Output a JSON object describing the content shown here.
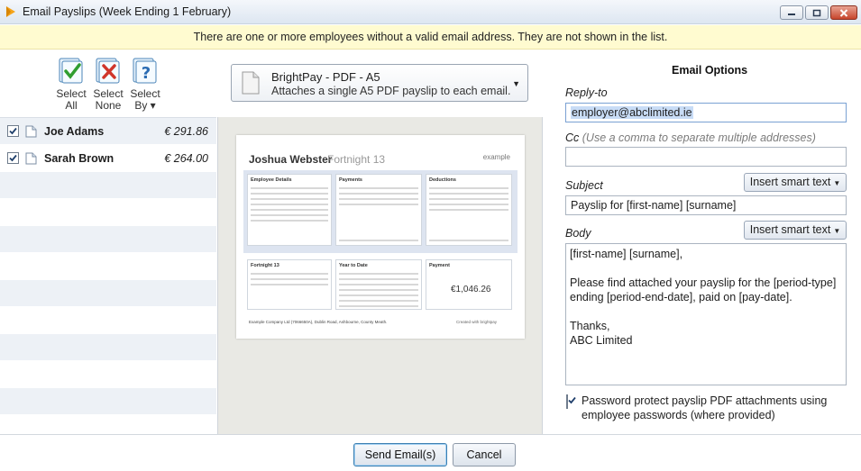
{
  "window": {
    "title": "Email Payslips (Week Ending 1 February)"
  },
  "warning": "There are one or more employees without a valid email address. They are not shown in the list.",
  "selection": {
    "select_all": [
      "Select",
      "All"
    ],
    "select_none": [
      "Select",
      "None"
    ],
    "select_by": [
      "Select",
      "By ▾"
    ]
  },
  "employees": [
    {
      "name": "Joe Adams",
      "amount": "€ 291.86",
      "checked": true
    },
    {
      "name": "Sarah Brown",
      "amount": "€ 264.00",
      "checked": true
    }
  ],
  "template": {
    "name": "BrightPay - PDF - A5",
    "description": "Attaches a single A5 PDF payslip to each email."
  },
  "preview": {
    "employee_name": "Joshua Webster",
    "period": "Fortnight 13",
    "logo_text": "example",
    "sections": {
      "employee_details": "Employee Details",
      "payments": "Payments",
      "deductions": "Deductions",
      "period": "Fortnight 13",
      "ytd": "Year to Date",
      "payment": "Payment"
    },
    "net_pay": "€1,046.26",
    "footer": "Example Company Ltd (7066650A), Dublin Road, Ashbourne, County Meath.",
    "created_with": "Created with brightpay"
  },
  "email_options": {
    "title": "Email Options",
    "reply_to_label": "Reply-to",
    "reply_to_value": "employer@abclimited.ie",
    "cc_label": "Cc",
    "cc_hint": "(Use a comma to separate multiple addresses)",
    "cc_value": "",
    "subject_label": "Subject",
    "subject_value": "Payslip for [first-name] [surname]",
    "body_label": "Body",
    "body_value": "[first-name] [surname],\n\nPlease find attached your payslip for the [period-type]\nending [period-end-date], paid on [pay-date].\n\nThanks,\nABC Limited",
    "insert_smart_text": "Insert smart text",
    "password_protect": "Password protect payslip PDF attachments using employee passwords (where provided)",
    "password_checked": true
  },
  "buttons": {
    "send": "Send Email(s)",
    "cancel": "Cancel"
  },
  "colors": {
    "warning_bg": "#fffbd0",
    "list_alt_row": "#edf1f6",
    "preview_bg": "#e9e9e4",
    "accent": "#f5a41a"
  }
}
